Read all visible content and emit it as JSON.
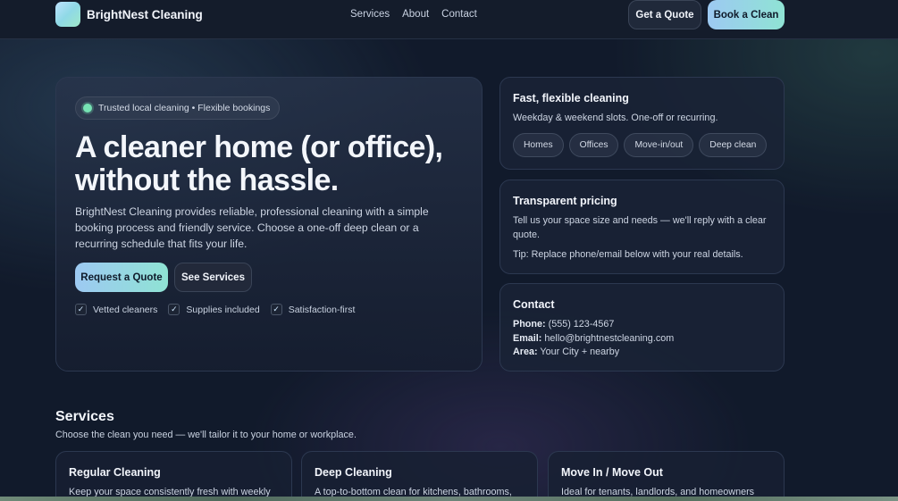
{
  "nav": {
    "brand": "BrightNest Cleaning",
    "links": [
      "Services",
      "About",
      "Contact"
    ],
    "quote_button": "Get a Quote",
    "book_button": "Book a Clean"
  },
  "hero": {
    "badge": "Trusted local cleaning • Flexible bookings",
    "title": "A cleaner home (or office), without the hassle.",
    "description": "BrightNest Cleaning provides reliable, professional cleaning with a simple booking process and friendly service. Choose a one-off deep clean or a recurring schedule that fits your life.",
    "primary_button": "Request a Quote",
    "secondary_button": "See Services",
    "checks": [
      "Vetted cleaners",
      "Supplies included",
      "Satisfaction-first"
    ]
  },
  "cards": {
    "flexible": {
      "title": "Fast, flexible cleaning",
      "text": "Weekday & weekend slots. One-off or recurring.",
      "tags": [
        "Homes",
        "Offices",
        "Move-in/out",
        "Deep clean"
      ]
    },
    "pricing": {
      "title": "Transparent pricing",
      "text": "Tell us your space size and needs — we'll reply with a clear quote.",
      "tip": "Tip: Replace phone/email below with your real details."
    },
    "contact": {
      "title": "Contact",
      "phone_label": "Phone:",
      "phone": "(555) 123-4567",
      "email_label": "Email:",
      "email": "hello@brightnestcleaning.com",
      "area_label": "Area:",
      "area": "Your City + nearby"
    }
  },
  "services": {
    "title": "Services",
    "subtitle": "Choose the clean you need — we'll tailor it to your home or workplace.",
    "items": [
      {
        "title": "Regular Cleaning",
        "text": "Keep your space consistently fresh with weekly"
      },
      {
        "title": "Deep Cleaning",
        "text": "A top-to-bottom clean for kitchens, bathrooms,"
      },
      {
        "title": "Move In / Move Out",
        "text": "Ideal for tenants, landlords, and homeowners"
      }
    ]
  },
  "colors": {
    "accent_gradient_start": "#9dc9f2",
    "accent_gradient_end": "#8fe3d4",
    "background": "#111a2b",
    "status_dot": "#76e3b4"
  },
  "icons": {
    "logo": "brand-logo-icon",
    "status": "status-dot-icon",
    "check": "check-icon"
  }
}
